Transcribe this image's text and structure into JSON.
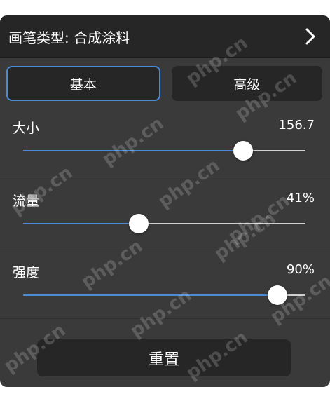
{
  "header": {
    "title": "画笔类型: 合成涂料",
    "chevron_icon": "chevron-right-icon"
  },
  "tabs": [
    {
      "label": "基本",
      "active": true
    },
    {
      "label": "高级",
      "active": false
    }
  ],
  "sliders": {
    "size": {
      "label": "大小",
      "value": "156.7",
      "fraction": 0.78
    },
    "flow": {
      "label": "流量",
      "value": "41%",
      "fraction": 0.41
    },
    "strength": {
      "label": "强度",
      "value": "90%",
      "fraction": 0.9
    }
  },
  "reset": {
    "label": "重置"
  },
  "watermark": {
    "text": "php.cn"
  },
  "colors": {
    "accent": "#4a8bd4",
    "panel_bg": "#3a3a3a",
    "header_bg": "#262626"
  }
}
